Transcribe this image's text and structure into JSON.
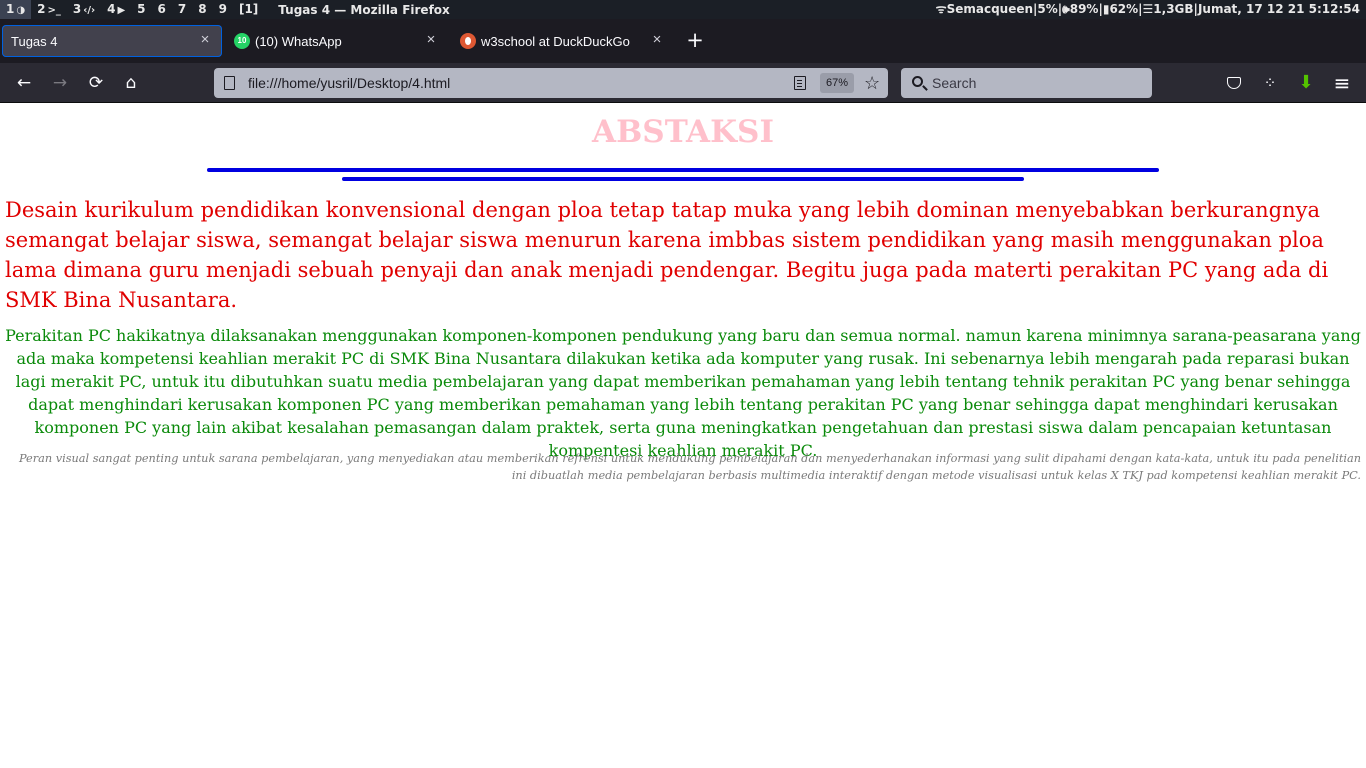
{
  "system_bar": {
    "workspaces": [
      {
        "num": "1",
        "glyph": "◑"
      },
      {
        "num": "2",
        "glyph": ">_"
      },
      {
        "num": "3",
        "glyph": "‹/›"
      },
      {
        "num": "4",
        "glyph": "▶"
      },
      {
        "num": "5",
        "glyph": ""
      },
      {
        "num": "6",
        "glyph": ""
      },
      {
        "num": "7",
        "glyph": ""
      },
      {
        "num": "8",
        "glyph": ""
      },
      {
        "num": "9",
        "glyph": ""
      },
      {
        "num": "[1]",
        "glyph": ""
      }
    ],
    "window_title": "Tugas 4 — Mozilla Firefox",
    "status": "ᯤSemacqueen|5%|🕪89%|▮62%|☰1,3GB|Jumat, 17 12 21 5:12:54"
  },
  "tabs": [
    {
      "label": "Tugas 4",
      "selected": true
    },
    {
      "label": "(10) WhatsApp",
      "icon": "whatsapp-favicon",
      "badge": "10"
    },
    {
      "label": "w3school at DuckDuckGo",
      "icon": "duckduckgo-favicon"
    }
  ],
  "toolbar": {
    "back_icon": "←",
    "forward_icon": "→",
    "reload_icon": "⟳",
    "home_icon": "⌂",
    "url": "file:///home/yusril/Desktop/4.html",
    "zoom": "67%",
    "bookmark_icon": "☆",
    "search_placeholder": "Search",
    "close_icon": "×",
    "new_tab_icon": "+",
    "menu_icon": "≡",
    "extension_icon": "⁘",
    "download_icon": "⬇"
  },
  "page": {
    "heading": "ABSTAKSI",
    "heading_color": "#ffc0cb",
    "rule_color": "#0000e0",
    "red_paragraph": "Desain kurikulum pendidikan konvensional dengan ploa tetap tatap muka yang lebih dominan menyebabkan berkurangnya semangat belajar siswa, semangat belajar siswa menurun karena imbbas sistem pendidikan yang masih menggunakan ploa lama dimana guru menjadi sebuah penyaji dan anak menjadi pendengar. Begitu juga pada materti perakitan PC yang ada di SMK Bina Nusantara.",
    "green_paragraph": "Perakitan PC hakikatnya dilaksanakan menggunakan komponen-komponen pendukung yang baru dan semua normal. namun karena minimnya sarana-peasarana yang ada maka kompetensi keahlian merakit PC di SMK Bina Nusantara dilakukan ketika ada komputer yang rusak. Ini sebenarnya lebih mengarah pada reparasi bukan lagi merakit PC, untuk itu dibutuhkan suatu media pembelajaran yang dapat memberikan pemahaman yang lebih tentang tehnik perakitan PC yang benar sehingga dapat menghindari kerusakan komponen PC yang memberikan pemahaman yang lebih tentang perakitan PC yang benar sehingga dapat menghindari kerusakan komponen PC yang lain akibat kesalahan pemasangan dalam praktek, serta guna meningkatkan pengetahuan dan prestasi siswa dalam pencapaian ketuntasan kompentesi keahlian merakit PC.",
    "gray_paragraph": "Peran visual sangat penting untuk sarana pembelajaran, yang menyediakan atau memberikan refrensi untuk mendukung pembelajaran dan menyederhanakan informasi yang sulit dipahami dengan kata-kata, untuk itu pada penelitian ini dibuatlah media pembelajaran berbasis multimedia interaktif dengan metode visualisasi untuk kelas X TKJ pad kompetensi keahlian merakit PC."
  }
}
